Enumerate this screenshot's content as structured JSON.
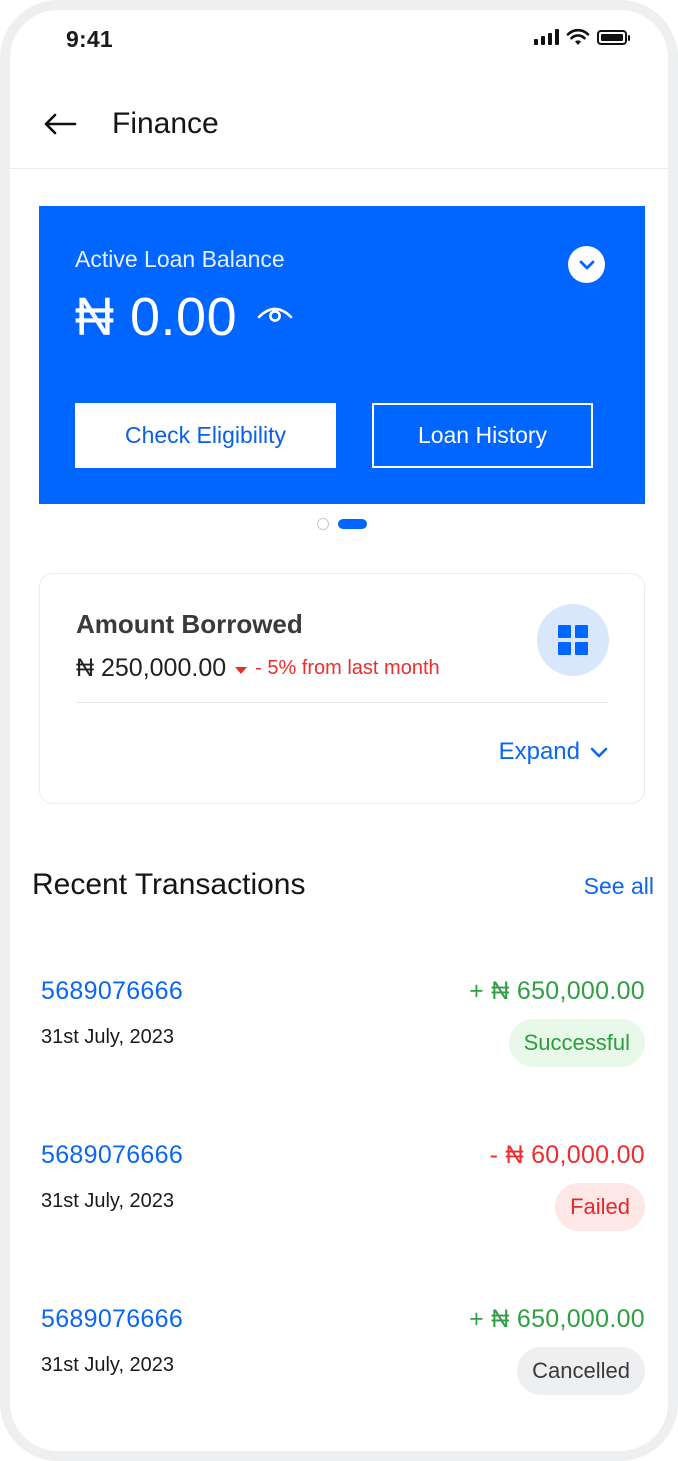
{
  "status_bar": {
    "time": "9:41"
  },
  "header": {
    "title": "Finance",
    "back_icon": "arrow-left-icon"
  },
  "loan_card": {
    "label": "Active Loan Balance",
    "amount": "₦ 0.00",
    "eye_icon": "eye-icon",
    "toggle_icon": "chevron-down-icon",
    "check_eligibility_label": "Check Eligibility",
    "loan_history_label": "Loan History",
    "background_color": "#0066ff"
  },
  "pager": {
    "page_count": 2,
    "active_page": 2
  },
  "amount_borrowed": {
    "title": "Amount Borrowed",
    "value": "₦ 250,000.00",
    "change": "- 5% from last month",
    "change_color": "#ee2c2c",
    "grid_icon": "grid-icon",
    "expand_label": "Expand"
  },
  "transactions": {
    "title": "Recent Transactions",
    "see_all_label": "See all",
    "items": [
      {
        "id": "5689076666",
        "date": "31st July, 2023",
        "amount": "+ ₦ 650,000.00",
        "amount_color": "#2ea043",
        "status": "Successful",
        "status_bg": "#e9f9e9",
        "status_color": "#2a9d3e"
      },
      {
        "id": "5689076666",
        "date": "31st July, 2023",
        "amount": "- ₦ 60,000.00",
        "amount_color": "#ee2c2c",
        "status": "Failed",
        "status_bg": "#fde7e7",
        "status_color": "#e52828"
      },
      {
        "id": "5689076666",
        "date": "31st July, 2023",
        "amount": "+ ₦ 650,000.00",
        "amount_color": "#2ea043",
        "status": "Cancelled",
        "status_bg": "#eeeff1",
        "status_color": "#3a3a3a"
      }
    ]
  }
}
